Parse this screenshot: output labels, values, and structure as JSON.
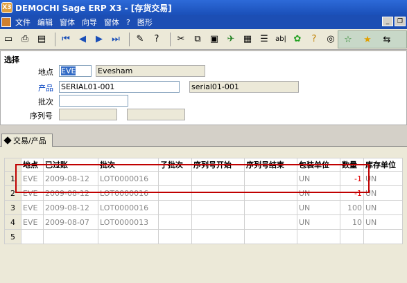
{
  "window": {
    "title": "DEMOCHI Sage ERP X3 - [存货交易]",
    "app_icon_label": "X3"
  },
  "menu": {
    "items": [
      "文件",
      "编辑",
      "窗体",
      "向导",
      "窗体",
      "?",
      "图形"
    ]
  },
  "toolbar": {
    "buttons": [
      "new-icon",
      "print-icon",
      "preview-icon",
      "first-icon",
      "prev-icon",
      "next-icon",
      "last-icon",
      "attach-icon",
      "help-icon",
      "cut-icon",
      "copy-icon",
      "paste-icon",
      "function-icon",
      "table-icon",
      "text-icon",
      "refresh-icon",
      "question-icon",
      "web-icon",
      "home-icon",
      "star-icon",
      "signpost-icon"
    ],
    "text_button": "ab|"
  },
  "selection": {
    "legend": "选择",
    "site_label": "地点",
    "site_value": "EVE",
    "site_desc": "Evesham",
    "product_label": "产品",
    "product_value": "SERIAL01-001",
    "product_desc": "serial01-001",
    "lot_label": "批次",
    "lot_value": "",
    "serial_label": "序列号",
    "serial_from": "",
    "serial_to": ""
  },
  "tabs": [
    {
      "label": "交易/产品"
    }
  ],
  "grid": {
    "columns": [
      "",
      "地点",
      "已过账",
      "批次",
      "子批次",
      "序列号开始",
      "序列号结束",
      "包装单位",
      "数量",
      "库存单位"
    ],
    "rows": [
      {
        "n": "1",
        "site": "EVE",
        "date": "2009-08-12",
        "lot": "LOT0000016",
        "sublot": "",
        "sfrom": "",
        "sto": "",
        "pu": "UN",
        "qty": "-1",
        "su": "UN"
      },
      {
        "n": "2",
        "site": "EVE",
        "date": "2009-08-12",
        "lot": "LOT0000016",
        "sublot": "",
        "sfrom": "",
        "sto": "",
        "pu": "UN",
        "qty": "-1",
        "su": "UN"
      },
      {
        "n": "3",
        "site": "EVE",
        "date": "2009-08-12",
        "lot": "LOT0000016",
        "sublot": "",
        "sfrom": "",
        "sto": "",
        "pu": "UN",
        "qty": "100",
        "su": "UN"
      },
      {
        "n": "4",
        "site": "EVE",
        "date": "2009-08-07",
        "lot": "LOT0000013",
        "sublot": "",
        "sfrom": "",
        "sto": "",
        "pu": "UN",
        "qty": "10",
        "su": "UN"
      },
      {
        "n": "5",
        "site": "",
        "date": "",
        "lot": "",
        "sublot": "",
        "sfrom": "",
        "sto": "",
        "pu": "",
        "qty": "",
        "su": ""
      }
    ]
  },
  "colors": {
    "title_bar": "#1a4fb8",
    "highlight_box": "#c00000",
    "negative_qty": "#e00000"
  }
}
